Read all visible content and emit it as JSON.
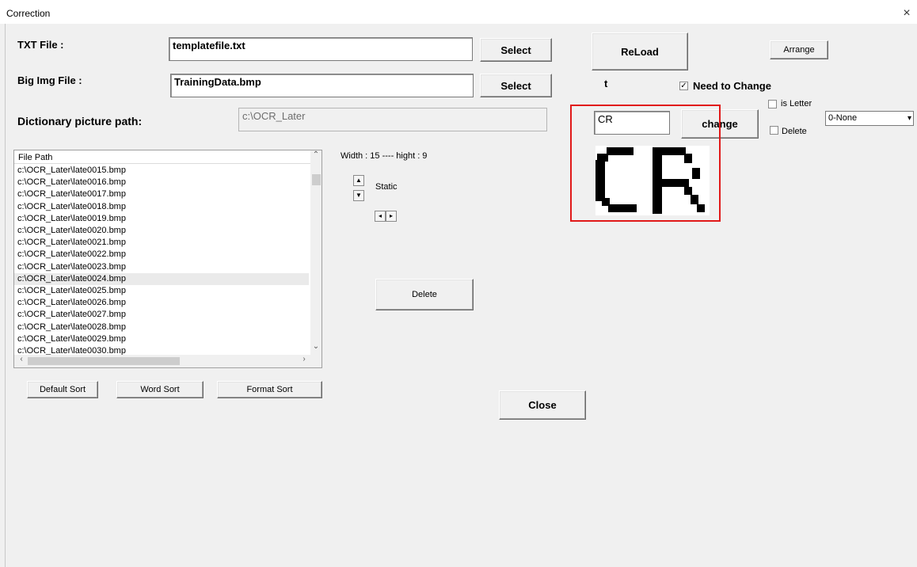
{
  "window": {
    "title": "Correction",
    "close_glyph": "×"
  },
  "form": {
    "txt_file_label": "TXT File :",
    "txt_file_value": "templatefile.txt",
    "big_img_label": "Big Img File :",
    "big_img_value": "TrainingData.bmp",
    "dict_path_label": "Dictionary picture path:",
    "dict_path_value": "c:\\OCR_Later",
    "select_label": "Select",
    "reload_label": "ReLoad",
    "arrange_label": "Arrange",
    "t_label": "t"
  },
  "correction": {
    "need_to_change_label": "Need to Change",
    "need_to_change_checked": true,
    "check_mark": "✓",
    "char_value": "CR",
    "change_label": "change",
    "is_letter_label": "is Letter",
    "delete_check_label": "Delete",
    "dropdown_value": "0-None",
    "dropdown_arrow": "▾",
    "preview_text": "CR"
  },
  "file_list": {
    "header": "File Path",
    "selected_index": 9,
    "items": [
      "c:\\OCR_Later\\late0015.bmp",
      "c:\\OCR_Later\\late0016.bmp",
      "c:\\OCR_Later\\late0017.bmp",
      "c:\\OCR_Later\\late0018.bmp",
      "c:\\OCR_Later\\late0019.bmp",
      "c:\\OCR_Later\\late0020.bmp",
      "c:\\OCR_Later\\late0021.bmp",
      "c:\\OCR_Later\\late0022.bmp",
      "c:\\OCR_Later\\late0023.bmp",
      "c:\\OCR_Later\\late0024.bmp",
      "c:\\OCR_Later\\late0025.bmp",
      "c:\\OCR_Later\\late0026.bmp",
      "c:\\OCR_Later\\late0027.bmp",
      "c:\\OCR_Later\\late0028.bmp",
      "c:\\OCR_Later\\late0029.bmp",
      "c:\\OCR_Later\\late0030.bmp"
    ]
  },
  "scroll_glyphs": {
    "up": "⌃",
    "down": "⌄",
    "left": "‹",
    "right": "›",
    "spin_up": "▲",
    "spin_down": "▼",
    "spin_left": "◂",
    "spin_right": "▸"
  },
  "dimensions_text": "Width : 15 ---- hight : 9",
  "static_label": "Static",
  "delete_button_label": "Delete",
  "sort": {
    "default_label": "Default Sort",
    "word_label": "Word Sort",
    "format_label": "Format Sort"
  },
  "close_label": "Close",
  "colors": {
    "highlight_box": "#e11919",
    "background": "#f0f0f0"
  }
}
